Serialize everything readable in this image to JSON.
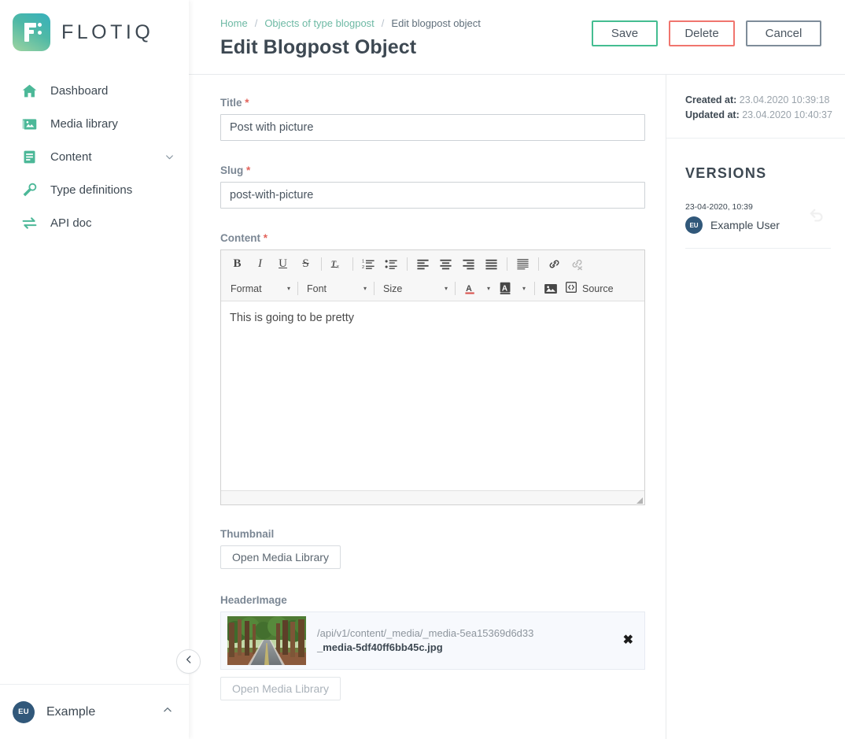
{
  "brand": {
    "name": "FLOTIQ",
    "logo_icon": "flotiq-f-logo-icon"
  },
  "sidebar": {
    "items": [
      {
        "label": "Dashboard",
        "icon": "home-icon",
        "name": "sidebar-item-dashboard",
        "caret": ""
      },
      {
        "label": "Media library",
        "icon": "image-stack-icon",
        "name": "sidebar-item-media-library",
        "caret": ""
      },
      {
        "label": "Content",
        "icon": "document-lines-icon",
        "name": "sidebar-item-content",
        "caret": "chevron-down-icon"
      },
      {
        "label": "Type definitions",
        "icon": "wrench-icon",
        "name": "sidebar-item-type-definitions",
        "caret": ""
      },
      {
        "label": "API doc",
        "icon": "arrows-exchange-icon",
        "name": "sidebar-item-api-doc",
        "caret": ""
      }
    ],
    "collapse_icon": "chevron-left-icon",
    "user": {
      "initials": "EU",
      "name": "Example",
      "caret_icon": "chevron-up-icon"
    }
  },
  "header": {
    "breadcrumb": [
      {
        "label": "Home",
        "link": true
      },
      {
        "label": "Objects of type blogpost",
        "link": true
      },
      {
        "label": "Edit blogpost object",
        "link": false
      }
    ],
    "breadcrumb_separator": "/",
    "title": "Edit Blogpost Object",
    "buttons": {
      "save": "Save",
      "delete": "Delete",
      "cancel": "Cancel"
    }
  },
  "form": {
    "title_field": {
      "label": "Title",
      "required_mark": "*",
      "value": "Post with picture",
      "placeholder": ""
    },
    "slug_field": {
      "label": "Slug",
      "required_mark": "*",
      "value": "post-with-picture",
      "placeholder": ""
    },
    "content_field": {
      "label": "Content",
      "required_mark": "*",
      "value": "This is going to be pretty"
    },
    "thumbnail_field": {
      "label": "Thumbnail",
      "button": "Open Media Library"
    },
    "headerimage_field": {
      "label": "HeaderImage",
      "button": "Open Media Library",
      "path": "/api/v1/content/_media/_media-5ea15369d6d33",
      "filename": "_media-5df40ff6bb45c.jpg",
      "remove_glyph": "✖",
      "thumb_alt": "road-through-redwood-forest"
    }
  },
  "editor": {
    "row1": [
      {
        "icon": "bold-icon",
        "glyph": "B",
        "kind": "bold",
        "disabled": false
      },
      {
        "icon": "italic-icon",
        "glyph": "I",
        "kind": "italic",
        "disabled": false
      },
      {
        "icon": "underline-icon",
        "glyph": "U",
        "kind": "under",
        "disabled": false
      },
      {
        "icon": "strikethrough-icon",
        "glyph": "S",
        "kind": "strike",
        "disabled": false
      },
      {
        "icon": "separator",
        "glyph": "",
        "kind": "sep",
        "disabled": false
      },
      {
        "icon": "remove-format-icon",
        "glyph": "Tx",
        "kind": "tx",
        "disabled": false
      },
      {
        "icon": "separator",
        "glyph": "",
        "kind": "sep",
        "disabled": false
      },
      {
        "icon": "numbered-list-icon",
        "glyph": "",
        "kind": "ol",
        "disabled": false
      },
      {
        "icon": "bulleted-list-icon",
        "glyph": "",
        "kind": "ul",
        "disabled": false
      },
      {
        "icon": "separator",
        "glyph": "",
        "kind": "sep",
        "disabled": false
      },
      {
        "icon": "align-left-icon",
        "glyph": "",
        "kind": "al",
        "disabled": false
      },
      {
        "icon": "align-center-icon",
        "glyph": "",
        "kind": "ac",
        "disabled": false
      },
      {
        "icon": "align-right-icon",
        "glyph": "",
        "kind": "ar",
        "disabled": false
      },
      {
        "icon": "align-justify-icon",
        "glyph": "",
        "kind": "aj",
        "disabled": false
      },
      {
        "icon": "separator",
        "glyph": "",
        "kind": "sep",
        "disabled": false
      },
      {
        "icon": "blockquote-icon",
        "glyph": "",
        "kind": "bq",
        "disabled": false
      },
      {
        "icon": "separator",
        "glyph": "",
        "kind": "sep",
        "disabled": false
      },
      {
        "icon": "link-icon",
        "glyph": "",
        "kind": "link",
        "disabled": false
      },
      {
        "icon": "unlink-icon",
        "glyph": "",
        "kind": "unlink",
        "disabled": true
      }
    ],
    "format_select": {
      "label": "Format",
      "arrow": "▾"
    },
    "font_select": {
      "label": "Font",
      "arrow": "▾"
    },
    "size_select": {
      "label": "Size",
      "arrow": "▾"
    },
    "text_color": {
      "icon": "text-color-icon",
      "arrow": "▾"
    },
    "bg_color": {
      "icon": "background-color-icon",
      "arrow": "▾"
    },
    "image_button": {
      "icon": "insert-image-icon"
    },
    "source_button": {
      "icon": "source-code-icon",
      "label": "Source"
    },
    "resize_handle": "resize-grip-icon"
  },
  "rightpanel": {
    "created_label": "Created at:",
    "created_value": "23.04.2020 10:39:18",
    "updated_label": "Updated at:",
    "updated_value": "23.04.2020 10:40:37",
    "versions_heading": "VERSIONS",
    "versions": [
      {
        "date": "23-04-2020, 10:39",
        "initials": "EU",
        "user": "Example User",
        "restore_icon": "undo-icon"
      }
    ]
  },
  "colors": {
    "brand_green": "#44bd91",
    "icon_green": "#4cb898",
    "danger_red": "#f0756e",
    "cancel_gray": "#7e8c99",
    "text_dark": "#3d4852",
    "text_muted": "#7b8794",
    "link_teal": "#6db9a4",
    "avatar_navy": "#31587a",
    "panel_bg": "#f7f9fd"
  }
}
